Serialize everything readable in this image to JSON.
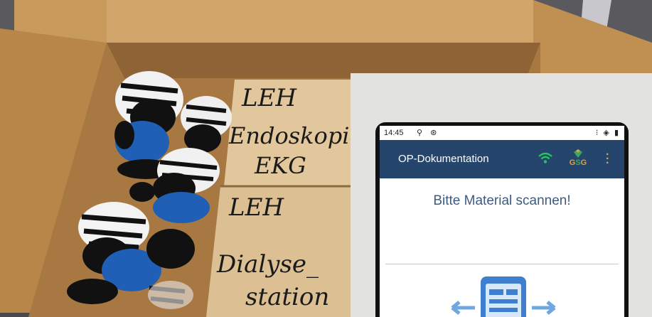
{
  "photo": {
    "box_label_top": {
      "line1": "LEH",
      "line2": "Endoskopie/",
      "line3": "EKG"
    },
    "box_label_bottom": {
      "line1": "LEH",
      "line2": "Dialyse_",
      "line3": "station"
    }
  },
  "app": {
    "status": {
      "time": "14:45",
      "left_icons": "⚲ ⊛",
      "right_icons": "⁝ ◈ ▮"
    },
    "title": "OP-Dokumentation",
    "logo_text": "GSG",
    "prompt": "Bitte Material scannen!",
    "colors": {
      "appbar": "#26456c",
      "wifi": "#22c55e",
      "prompt": "#3d5a80",
      "logo_g": "#d9a441",
      "logo_s": "#3aa85f"
    },
    "icons": [
      "wifi-icon",
      "gsg-logo",
      "overflow-menu-icon",
      "scan-material-icon"
    ]
  }
}
